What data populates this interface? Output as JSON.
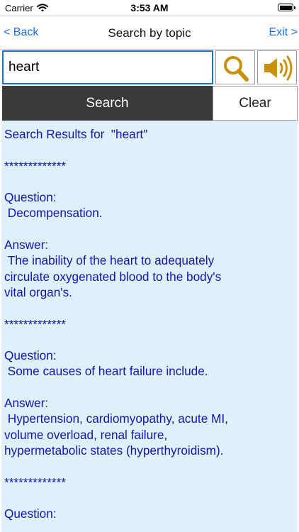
{
  "status_bar": {
    "carrier": "Carrier",
    "time": "3:53 AM"
  },
  "nav": {
    "back_label": "< Back",
    "title": "Search by topic",
    "exit_label": "Exit >"
  },
  "search": {
    "query": "heart",
    "search_button_label": "Search",
    "clear_button_label": "Clear",
    "icons": [
      "magnifying-glass-icon",
      "speaker-icon"
    ]
  },
  "colors": {
    "accent_blue": "#1a6fe6",
    "result_text": "#1414b0",
    "result_background": "#dff1fc",
    "search_button_bg": "#3a3a3c",
    "icon_gold": "#c9900c"
  },
  "results": {
    "header": "Search Results for  \"heart\"",
    "separator": "*************",
    "question_label": "Question:",
    "answer_label": "Answer:",
    "entries": [
      {
        "question": " Decompensation.",
        "answer": " The inability of the heart to adequately\ncirculate oxygenated blood to the body's\nvital organ's."
      },
      {
        "question": " Some causes of heart failure include.",
        "answer": " Hypertension, cardiomyopathy, acute MI,\nvolume overload, renal failure,\nhypermetabolic states (hyperthyroidism)."
      }
    ]
  }
}
